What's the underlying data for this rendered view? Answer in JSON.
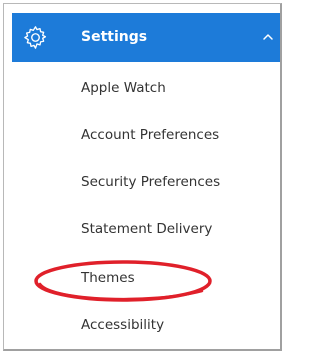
{
  "menu": {
    "header": {
      "title": "Settings",
      "icon": "gear-icon",
      "toggle_icon": "chevron-up-icon",
      "color": "#1d7bd9"
    },
    "items": [
      {
        "label": "Apple Watch"
      },
      {
        "label": "Account Preferences"
      },
      {
        "label": "Security Preferences"
      },
      {
        "label": "Statement Delivery"
      },
      {
        "label": "Themes"
      },
      {
        "label": "Accessibility"
      }
    ],
    "highlight": {
      "target": "Themes",
      "color": "#e0202a"
    }
  }
}
